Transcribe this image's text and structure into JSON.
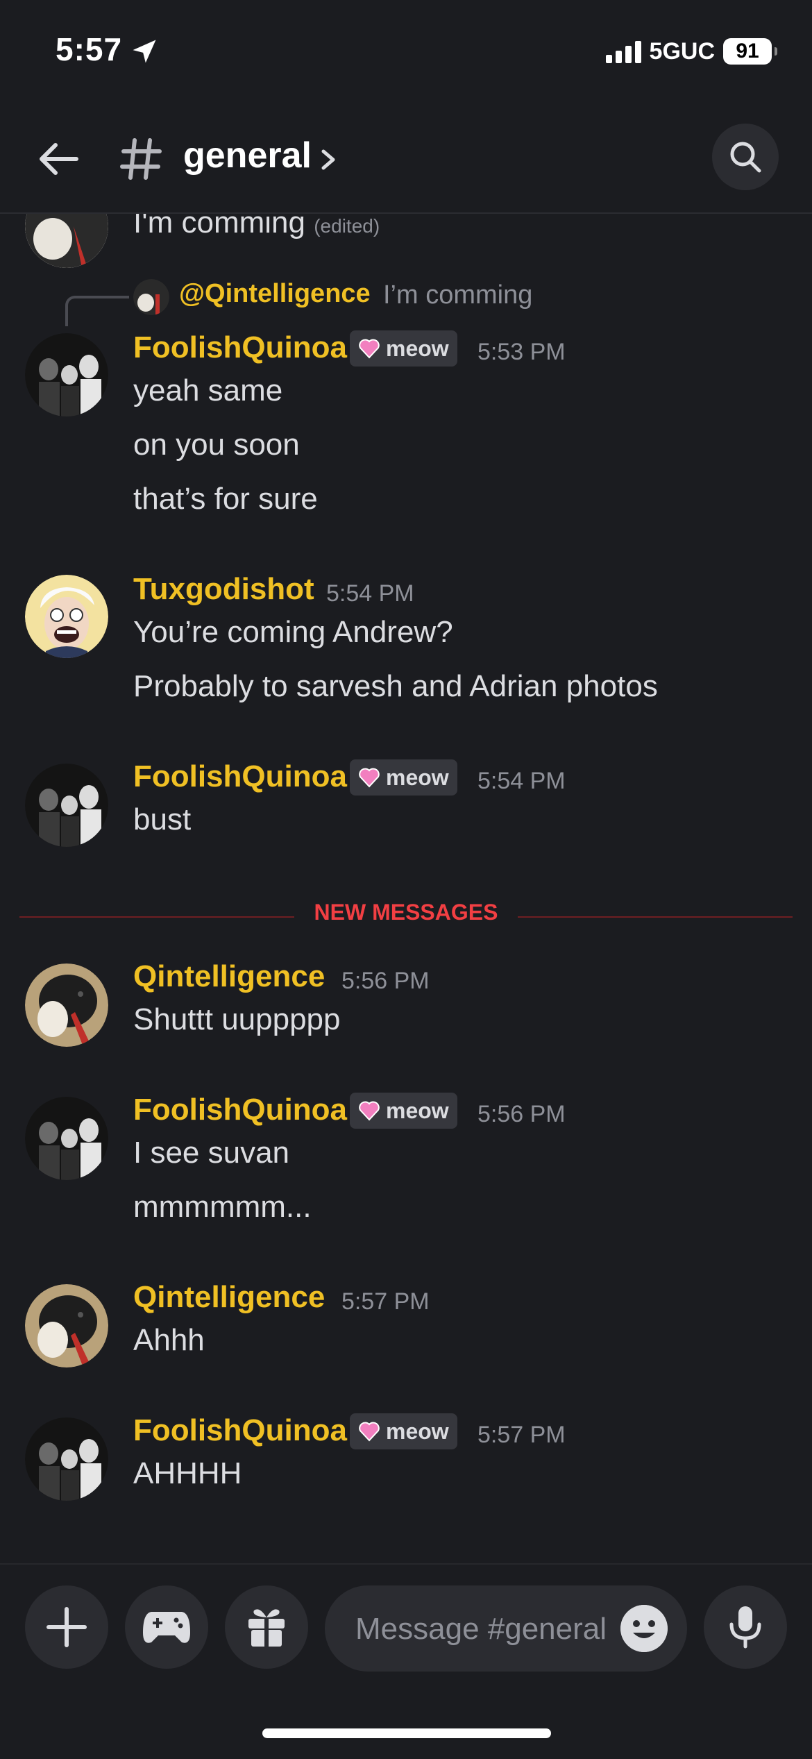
{
  "status_bar": {
    "time": "5:57",
    "network": "5GUC",
    "battery": "91"
  },
  "header": {
    "channel_name": "general"
  },
  "tag_label": "meow",
  "partial_message": {
    "text": "I'm comming",
    "edited": "(edited)"
  },
  "reply": {
    "mention": "@Qintelligence",
    "text": "I’m comming"
  },
  "messages": [
    {
      "author": "FoolishQuinoa",
      "tag": true,
      "time": "5:53 PM",
      "lines": [
        "yeah same",
        "on you soon",
        "that’s for sure"
      ]
    },
    {
      "author": "Tuxgodishot",
      "tag": false,
      "time": "5:54 PM",
      "lines": [
        "You’re coming Andrew?",
        "Probably to sarvesh and Adrian photos"
      ]
    },
    {
      "author": "FoolishQuinoa",
      "tag": true,
      "time": "5:54 PM",
      "lines": [
        "bust"
      ]
    },
    {
      "author": "Qintelligence",
      "tag": false,
      "time": "5:56 PM",
      "lines": [
        "Shuttt uuppppp"
      ]
    },
    {
      "author": "FoolishQuinoa",
      "tag": true,
      "time": "5:56 PM",
      "lines": [
        "I see suvan",
        "mmmmmm..."
      ]
    },
    {
      "author": "Qintelligence",
      "tag": false,
      "time": "5:57 PM",
      "lines": [
        "Ahhh"
      ]
    },
    {
      "author": "FoolishQuinoa",
      "tag": true,
      "time": "5:57 PM",
      "lines": [
        "AHHHH"
      ]
    }
  ],
  "divider": {
    "label": "NEW MESSAGES"
  },
  "composer": {
    "placeholder": "Message #general"
  },
  "colors": {
    "username": "#f0c024",
    "background": "#1b1c20",
    "new_messages": "#f23f43"
  }
}
